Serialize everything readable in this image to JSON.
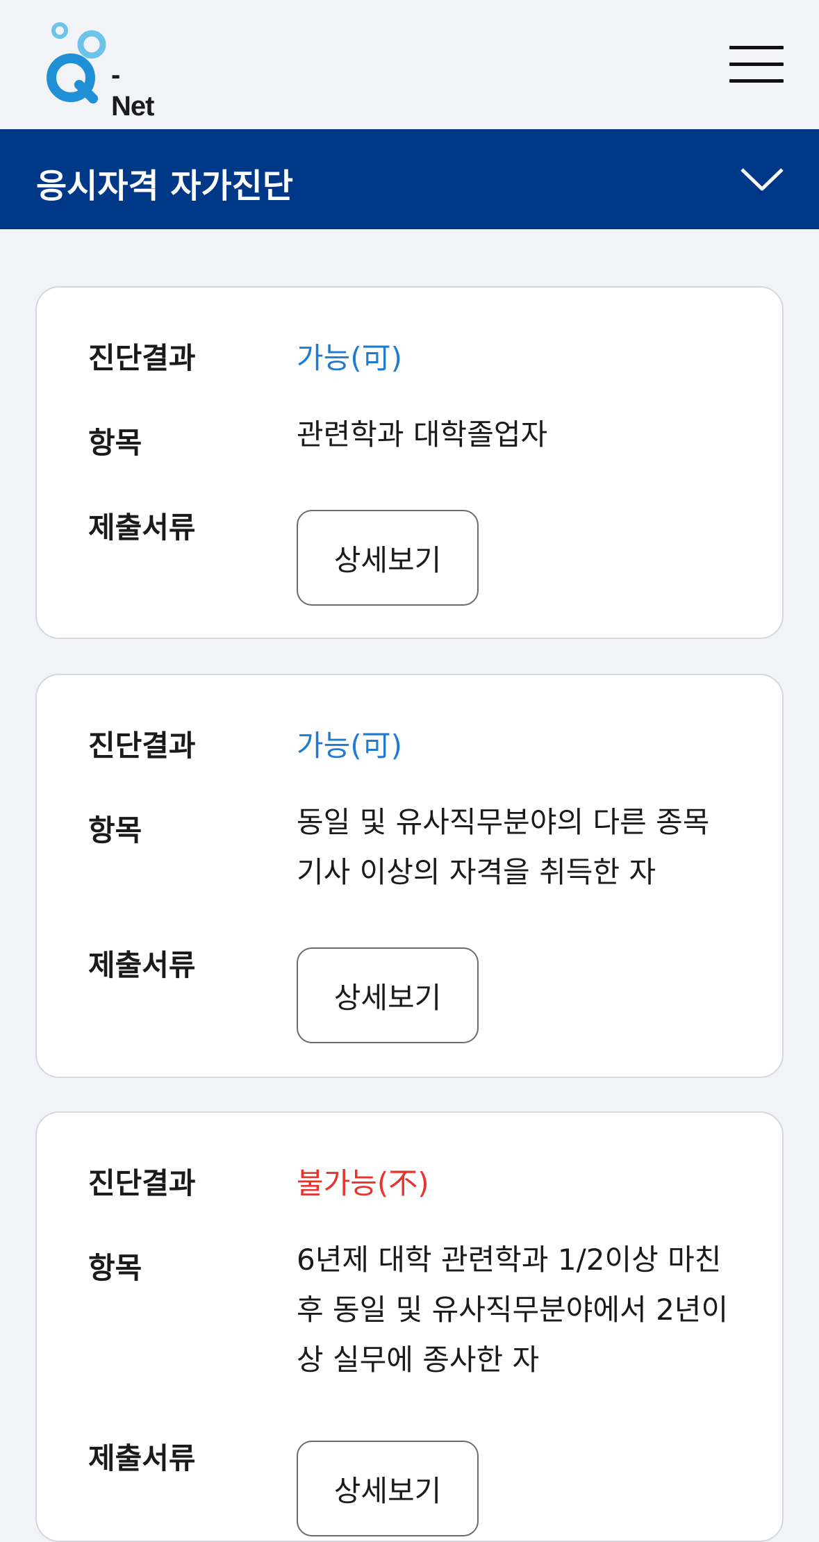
{
  "header": {
    "logo_text": "- Net",
    "menu_icon": "hamburger-icon"
  },
  "title_bar": {
    "title": "응시자격 자가진단",
    "toggle_icon": "chevron-down-icon"
  },
  "labels": {
    "result": "진단결과",
    "item": "항목",
    "documents": "제출서류"
  },
  "cards": [
    {
      "result": "가능(可)",
      "status": "ok",
      "item": "관련학과 대학졸업자",
      "button": "상세보기"
    },
    {
      "result": "가능(可)",
      "status": "ok",
      "item": "동일 및 유사직무분야의 다른 종목 기사 이상의 자격을 취득한 자",
      "button": "상세보기"
    },
    {
      "result": "불가능(不)",
      "status": "no",
      "item": "6년제 대학 관련학과 1/2이상 마친 후 동일 및 유사직무분야에서 2년이상 실무에 종사한 자",
      "button": "상세보기"
    }
  ],
  "colors": {
    "brand_blue": "#003888",
    "ok": "#1f7bd1",
    "no": "#e8322d",
    "logo_blue": "#1f8fd6",
    "logo_light": "#6ec3ea"
  }
}
